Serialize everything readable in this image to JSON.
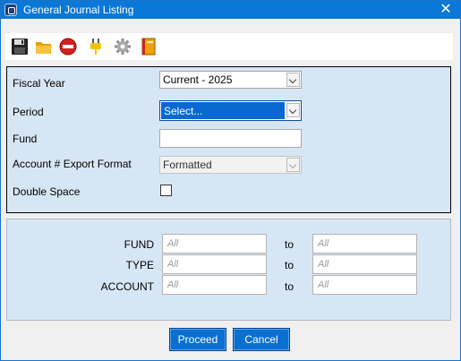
{
  "window": {
    "title": "General Journal Listing",
    "close_glyph": "✕"
  },
  "toolbar": {
    "items": [
      {
        "name": "save-icon",
        "color": "#222222"
      },
      {
        "name": "folder-icon",
        "color": "#f1b51b"
      },
      {
        "name": "stop-icon",
        "color": "#d32020"
      },
      {
        "name": "plug-icon",
        "color": "#f2c200"
      },
      {
        "name": "gear-icon",
        "color": "#8f8f8f"
      },
      {
        "name": "book-icon",
        "color": "#f0a000"
      }
    ]
  },
  "form": {
    "fiscal_year": {
      "label": "Fiscal Year",
      "value": "Current - 2025"
    },
    "period": {
      "label": "Period",
      "value": "Select..."
    },
    "fund": {
      "label": "Fund",
      "value": ""
    },
    "export_format": {
      "label": "Account # Export Format",
      "value": "Formatted"
    },
    "double_space": {
      "label": "Double Space",
      "checked": false
    }
  },
  "ranges": {
    "to_label": "to",
    "rows": [
      {
        "label": "FUND",
        "from_placeholder": "All",
        "to_placeholder": "All"
      },
      {
        "label": "TYPE",
        "from_placeholder": "All",
        "to_placeholder": "All"
      },
      {
        "label": "ACCOUNT",
        "from_placeholder": "All",
        "to_placeholder": "All"
      }
    ]
  },
  "buttons": {
    "proceed": "Proceed",
    "cancel": "Cancel"
  },
  "colors": {
    "titlebar": "#0a78d7",
    "panel": "#d7e6f5",
    "button": "#0a6fd1"
  }
}
